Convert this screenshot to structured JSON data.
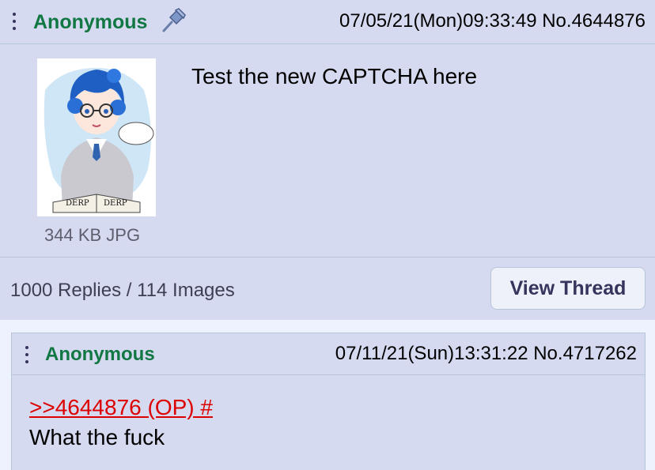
{
  "op": {
    "name": "Anonymous",
    "datetime": "07/05/21(Mon)09:33:49",
    "post_number": "No.4644876",
    "comment": "Test the new CAPTCHA here",
    "file_info": "344 KB JPG",
    "icons": {
      "menu": "vertical-dots-icon",
      "sticky": "pushpin-icon"
    }
  },
  "footer": {
    "reply_summary": "1000 Replies / 114 Images",
    "view_thread_label": "View Thread"
  },
  "reply": {
    "name": "Anonymous",
    "datetime": "07/11/21(Sun)13:31:22",
    "post_number": "No.4717262",
    "quote_link": ">>4644876 (OP) #",
    "comment": "What the fuck"
  },
  "thumbnail": {
    "book_text_left": "DERP",
    "book_text_right": "DERP"
  },
  "colors": {
    "background": "#eef2ff",
    "post": "#d6daf0",
    "border": "#b7c5d9",
    "name": "#117743",
    "quote": "#dd0000"
  }
}
